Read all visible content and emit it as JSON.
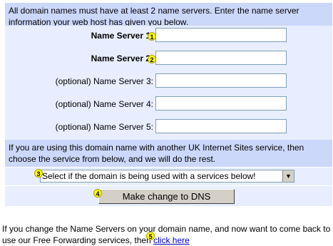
{
  "intro_text": "All domain names must have at least 2 name servers. Enter the name server information your web host has given you below.",
  "name_servers": [
    {
      "label": "Name Server 1:",
      "value": "",
      "badge": "1"
    },
    {
      "label": "Name Server 2:",
      "value": "",
      "badge": "2"
    },
    {
      "label": "(optional) Name Server 3:",
      "value": ""
    },
    {
      "label": "(optional) Name Server 4:",
      "value": ""
    },
    {
      "label": "(optional) Name Server 5:",
      "value": ""
    }
  ],
  "service_info": "If you are using this domain name with another UK Internet Sites service, then choose the service from below, and we will do the rest.",
  "service_select": {
    "selected": "Select if the domain is being used with a services below!",
    "badge": "3"
  },
  "submit": {
    "label": "Make change to DNS",
    "badge": "4"
  },
  "footer": {
    "text": "If you change the Name Servers on your domain name, and now want to come back to use our Free Forwarding services, then",
    "link": "click here",
    "badge": "5"
  },
  "colors": {
    "panel_dark": "#ccd8fa",
    "panel_light": "#e8eeff",
    "badge": "#ffff00",
    "link": "#0000cc"
  }
}
